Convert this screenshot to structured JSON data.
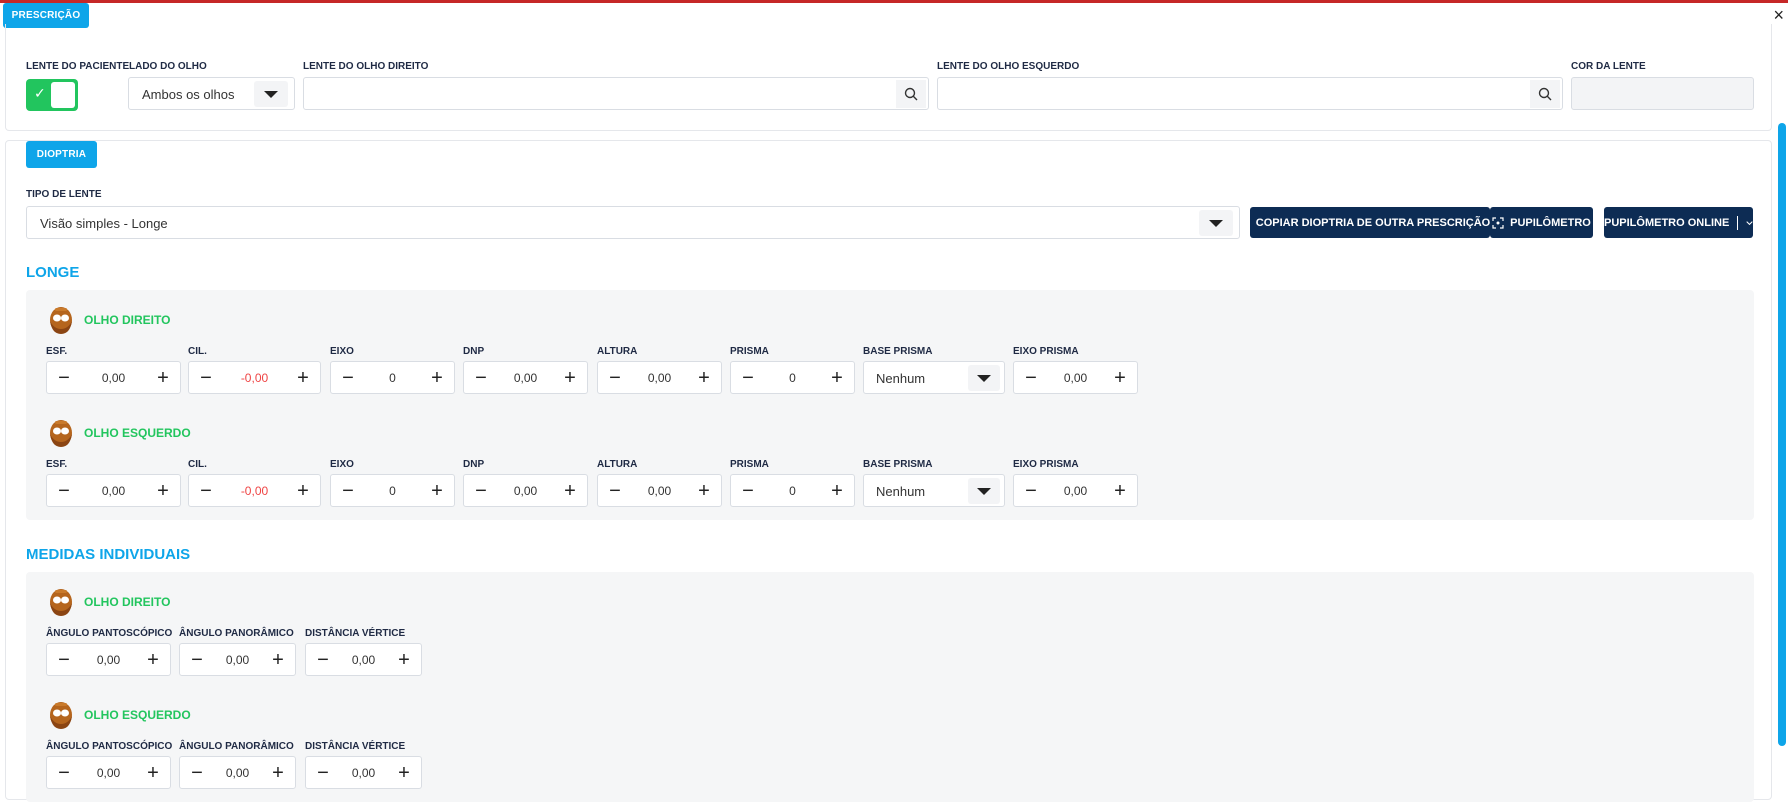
{
  "header": {
    "tab_label": "PRESCRIÇÃO",
    "close_glyph": "×"
  },
  "lens": {
    "patient_lens_label": "LENTE DO PACIENTE",
    "patient_lens_on": true,
    "eye_side_label": "LADO DO OLHO",
    "eye_side_value": "Ambos os olhos",
    "right_lens_label": "LENTE DO OLHO DIREITO",
    "right_lens_value": "",
    "left_lens_label": "LENTE DO OLHO ESQUERDO",
    "left_lens_value": "",
    "color_label": "COR DA LENTE",
    "color_value": ""
  },
  "dioptria": {
    "tab_label": "DIOPTRIA",
    "lens_type_label": "TIPO DE LENTE",
    "lens_type_value": "Visão simples - Longe",
    "copy_button": "COPIAR DIOPTRIA DE OUTRA PRESCRIÇÃO",
    "pupilometro_button": "PUPILÔMETRO",
    "pupilometro_online_button": "PUPILÔMETRO ONLINE"
  },
  "longe": {
    "title": "LONGE",
    "field_labels": [
      "ESF.",
      "CIL.",
      "EIXO",
      "DNP",
      "ALTURA",
      "PRISMA",
      "BASE PRISMA",
      "EIXO PRISMA"
    ],
    "right": {
      "title": "OLHO DIREITO",
      "esf": "0,00",
      "cil": "-0,00",
      "eixo": "0",
      "dnp": "0,00",
      "altura": "0,00",
      "prisma": "0",
      "base_prisma": "Nenhum",
      "eixo_prisma": "0,00"
    },
    "left": {
      "title": "OLHO ESQUERDO",
      "esf": "0,00",
      "cil": "-0,00",
      "eixo": "0",
      "dnp": "0,00",
      "altura": "0,00",
      "prisma": "0",
      "base_prisma": "Nenhum",
      "eixo_prisma": "0,00"
    }
  },
  "medidas": {
    "title": "MEDIDAS INDIVIDUAIS",
    "field_labels": [
      "ÂNGULO PANTOSCÓPICO",
      "ÂNGULO PANORÂMICO",
      "DISTÂNCIA VÉRTICE"
    ],
    "right": {
      "title": "OLHO DIREITO",
      "pantoscopico": "0,00",
      "panoramico": "0,00",
      "vertice": "0,00"
    },
    "left": {
      "title": "OLHO ESQUERDO",
      "pantoscopico": "0,00",
      "panoramico": "0,00",
      "vertice": "0,00"
    }
  },
  "icons": {
    "search": "search-icon",
    "caret": "caret-down-icon",
    "copy": "copy-icon",
    "scan": "scan-icon",
    "chevron": "chevron-down-icon",
    "avatar": "face-avatar-icon",
    "minus": "minus-icon",
    "plus": "plus-icon",
    "check": "check-icon",
    "close": "close-icon"
  },
  "colors": {
    "accent": "#0ea5e9",
    "success": "#22c55e",
    "dark_button": "#0d2c54",
    "negative": "#ef4444",
    "top_bar": "#c62828"
  },
  "stepper_glyphs": {
    "minus": "−",
    "plus": "+"
  }
}
